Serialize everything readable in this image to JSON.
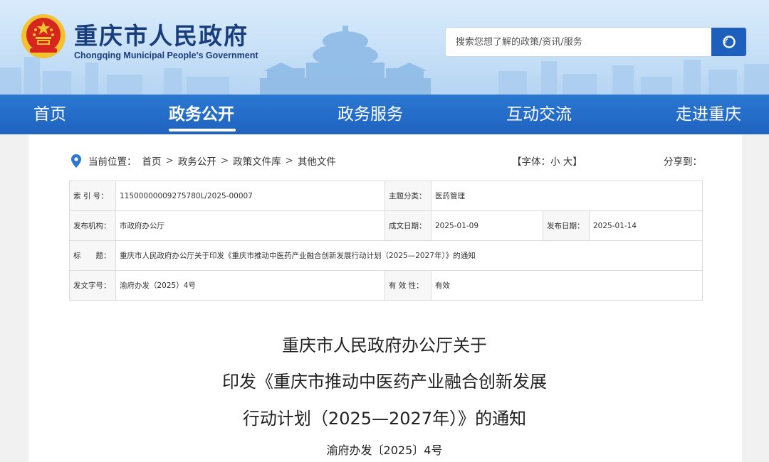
{
  "header": {
    "site_title": "重庆市人民政府",
    "site_subtitle": "Chongqing Municipal People's Government",
    "search_placeholder": "搜索您想了解的政策/资讯/服务"
  },
  "nav": {
    "items": [
      {
        "label": "首页",
        "active": false
      },
      {
        "label": "政务公开",
        "active": true
      },
      {
        "label": "政务服务",
        "active": false
      },
      {
        "label": "互动交流",
        "active": false
      },
      {
        "label": "走进重庆",
        "active": false
      }
    ]
  },
  "breadcrumb": {
    "prefix": "当前位置：",
    "items": [
      "首页",
      "政务公开",
      "政策文件库",
      "其他文件"
    ],
    "separator": ">"
  },
  "font_size": {
    "prefix": "【字体：",
    "small": "小",
    "large": "大",
    "suffix": "】"
  },
  "share_label": "分享到：",
  "meta": {
    "index_label": "索 引 号：",
    "index_value": "11500000009275780L/2025-00007",
    "category_label": "主题分类：",
    "category_value": "医药管理",
    "issuer_label": "发布机构：",
    "issuer_value": "市政府办公厅",
    "written_label": "成文日期：",
    "written_value": "2025-01-09",
    "published_label": "发布日期：",
    "published_value": "2025-01-14",
    "title_label": "标　　题：",
    "title_value": "重庆市人民政府办公厅关于印发《重庆市推动中医药产业融合创新发展行动计划（2025—2027年）》的通知",
    "doc_no_label": "发文字号：",
    "doc_no_value": "渝府办发（2025）4号",
    "validity_label": "有 效 性：",
    "validity_value": "有效"
  },
  "document": {
    "title_line1": "重庆市人民政府办公厅关于",
    "title_line2": "印发《重庆市推动中医药产业融合创新发展",
    "title_line3": "行动计划（2025—2027年）》的通知",
    "number": "渝府办发〔2025〕4号"
  },
  "colors": {
    "brand_blue": "#1f63bf",
    "title_blue": "#1a3e7d",
    "emblem_red": "#d7261e",
    "emblem_gold": "#f2c230"
  }
}
